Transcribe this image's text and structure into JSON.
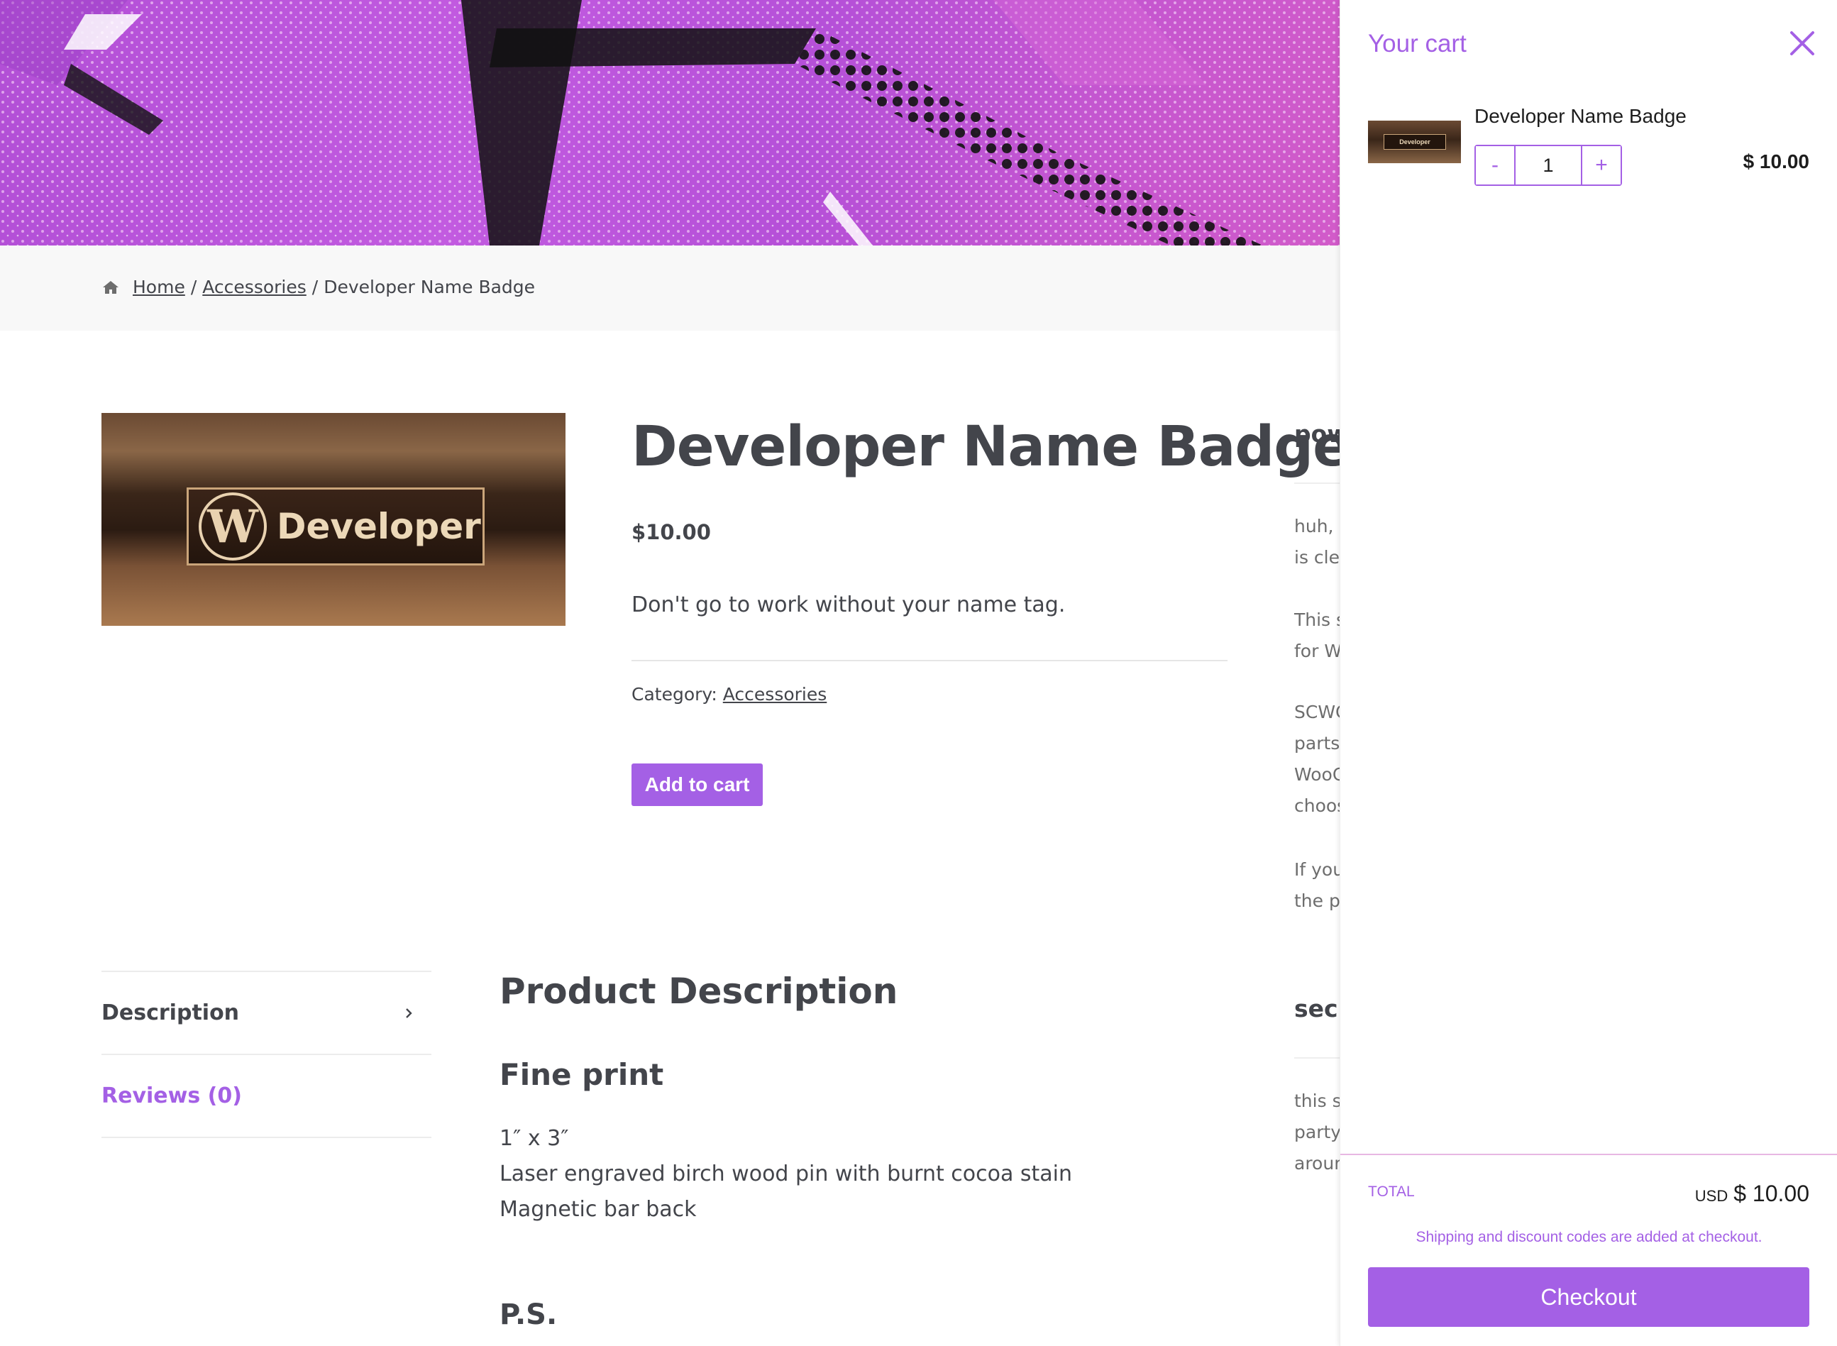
{
  "breadcrumb": {
    "home": "Home",
    "sep1": "/",
    "category": "Accessories",
    "sep2": "/",
    "current": "Developer Name Badge"
  },
  "product": {
    "title": "Developer Name Badge",
    "price": "$10.00",
    "short_description": "Don't go to work without your name tag.",
    "category_label": "Category:",
    "category": "Accessories",
    "add_to_cart": "Add to cart",
    "image_badge_text": "Developer"
  },
  "sidebar": {
    "heading1": "pow",
    "p1": [
      "huh, v",
      "is clea"
    ],
    "p2": [
      "This s",
      "for Wo"
    ],
    "p3": [
      "SCWC",
      "parts",
      "WooC",
      "choos"
    ],
    "p4": [
      "If you",
      "the pl"
    ],
    "heading2": "secr",
    "p5": [
      "this si",
      "party,",
      "aroun"
    ]
  },
  "tabs": [
    {
      "label": "Description"
    },
    {
      "label": "Reviews (0)"
    }
  ],
  "description": {
    "heading": "Product Description",
    "subheading": "Fine print",
    "lines": [
      "1″ x 3″",
      "Laser engraved birch wood pin with burnt cocoa stain",
      "Magnetic bar back"
    ],
    "ps": "P.S."
  },
  "cart": {
    "title": "Your cart",
    "item": {
      "name": "Developer Name Badge",
      "quantity": "1",
      "minus": "-",
      "plus": "+",
      "price": "$ 10.00",
      "thumb_text": "Developer"
    },
    "total_label": "TOTAL",
    "total_currency": "USD",
    "total_amount": "$ 10.00",
    "shipping_note": "Shipping and discount codes are added at checkout.",
    "checkout": "Checkout"
  },
  "colors": {
    "accent": "#a460e5",
    "text": "#43454b",
    "hero": "#c25be0"
  }
}
